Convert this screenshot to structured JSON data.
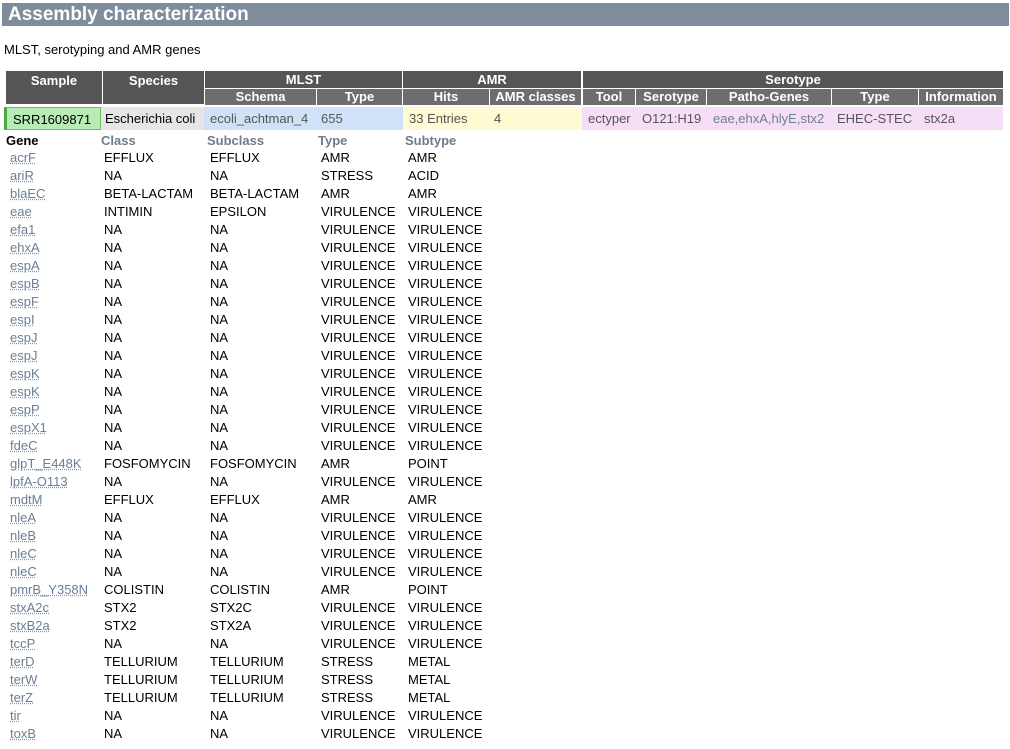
{
  "page": {
    "title": "Assembly characterization",
    "subtitle": "MLST, serotyping and AMR genes"
  },
  "summary": {
    "group_headers": {
      "sample": "Sample",
      "species": "Species",
      "mlst": "MLST",
      "amr": "AMR",
      "serotype": "Serotype"
    },
    "sub_headers": {
      "schema": "Schema",
      "type": "Type",
      "hits": "Hits",
      "amr_classes": "AMR classes",
      "tool": "Tool",
      "serotype": "Serotype",
      "patho_genes": "Patho-Genes",
      "sero_type": "Type",
      "information": "Information"
    },
    "row": {
      "sample": "SRR1609871",
      "species": "Escherichia coli",
      "schema": "ecoli_achtman_4",
      "mlst_type": "655",
      "hits": "33 Entries",
      "amr_classes": "4",
      "tool": "ectyper",
      "serotype": "O121:H19",
      "patho_genes": "eae,ehxA,hlyE,stx2",
      "sero_type": "EHEC-STEC",
      "information": "stx2a"
    }
  },
  "genes": {
    "headers": {
      "gene": "Gene",
      "class": "Class",
      "subclass": "Subclass",
      "type": "Type",
      "subtype": "Subtype"
    },
    "rows": [
      [
        "acrF",
        "EFFLUX",
        "EFFLUX",
        "AMR",
        "AMR"
      ],
      [
        "ariR",
        "NA",
        "NA",
        "STRESS",
        "ACID"
      ],
      [
        "blaEC",
        "BETA-LACTAM",
        "BETA-LACTAM",
        "AMR",
        "AMR"
      ],
      [
        "eae",
        "INTIMIN",
        "EPSILON",
        "VIRULENCE",
        "VIRULENCE"
      ],
      [
        "efa1",
        "NA",
        "NA",
        "VIRULENCE",
        "VIRULENCE"
      ],
      [
        "ehxA",
        "NA",
        "NA",
        "VIRULENCE",
        "VIRULENCE"
      ],
      [
        "espA",
        "NA",
        "NA",
        "VIRULENCE",
        "VIRULENCE"
      ],
      [
        "espB",
        "NA",
        "NA",
        "VIRULENCE",
        "VIRULENCE"
      ],
      [
        "espF",
        "NA",
        "NA",
        "VIRULENCE",
        "VIRULENCE"
      ],
      [
        "espI",
        "NA",
        "NA",
        "VIRULENCE",
        "VIRULENCE"
      ],
      [
        "espJ",
        "NA",
        "NA",
        "VIRULENCE",
        "VIRULENCE"
      ],
      [
        "espJ",
        "NA",
        "NA",
        "VIRULENCE",
        "VIRULENCE"
      ],
      [
        "espK",
        "NA",
        "NA",
        "VIRULENCE",
        "VIRULENCE"
      ],
      [
        "espK",
        "NA",
        "NA",
        "VIRULENCE",
        "VIRULENCE"
      ],
      [
        "espP",
        "NA",
        "NA",
        "VIRULENCE",
        "VIRULENCE"
      ],
      [
        "espX1",
        "NA",
        "NA",
        "VIRULENCE",
        "VIRULENCE"
      ],
      [
        "fdeC",
        "NA",
        "NA",
        "VIRULENCE",
        "VIRULENCE"
      ],
      [
        "glpT_E448K",
        "FOSFOMYCIN",
        "FOSFOMYCIN",
        "AMR",
        "POINT"
      ],
      [
        "lpfA-O113",
        "NA",
        "NA",
        "VIRULENCE",
        "VIRULENCE"
      ],
      [
        "mdtM",
        "EFFLUX",
        "EFFLUX",
        "AMR",
        "AMR"
      ],
      [
        "nleA",
        "NA",
        "NA",
        "VIRULENCE",
        "VIRULENCE"
      ],
      [
        "nleB",
        "NA",
        "NA",
        "VIRULENCE",
        "VIRULENCE"
      ],
      [
        "nleC",
        "NA",
        "NA",
        "VIRULENCE",
        "VIRULENCE"
      ],
      [
        "nleC",
        "NA",
        "NA",
        "VIRULENCE",
        "VIRULENCE"
      ],
      [
        "pmrB_Y358N",
        "COLISTIN",
        "COLISTIN",
        "AMR",
        "POINT"
      ],
      [
        "stxA2c",
        "STX2",
        "STX2C",
        "VIRULENCE",
        "VIRULENCE"
      ],
      [
        "stxB2a",
        "STX2",
        "STX2A",
        "VIRULENCE",
        "VIRULENCE"
      ],
      [
        "tccP",
        "NA",
        "NA",
        "VIRULENCE",
        "VIRULENCE"
      ],
      [
        "terD",
        "TELLURIUM",
        "TELLURIUM",
        "STRESS",
        "METAL"
      ],
      [
        "terW",
        "TELLURIUM",
        "TELLURIUM",
        "STRESS",
        "METAL"
      ],
      [
        "terZ",
        "TELLURIUM",
        "TELLURIUM",
        "STRESS",
        "METAL"
      ],
      [
        "tir",
        "NA",
        "NA",
        "VIRULENCE",
        "VIRULENCE"
      ],
      [
        "toxB",
        "NA",
        "NA",
        "VIRULENCE",
        "VIRULENCE"
      ]
    ]
  }
}
